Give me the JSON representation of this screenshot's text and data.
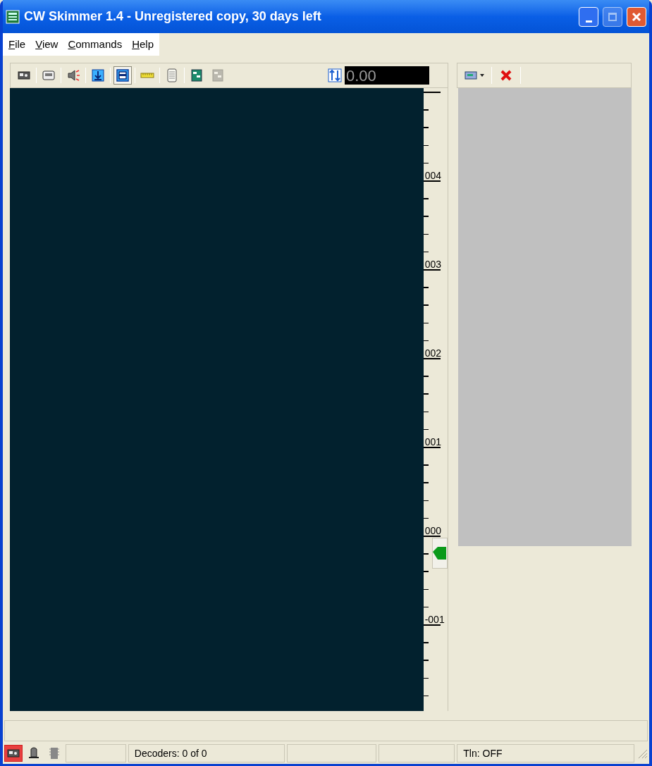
{
  "window": {
    "title": "CW Skimmer 1.4 - Unregistered copy, 30 days left"
  },
  "menu": [
    {
      "key": "F",
      "rest": "ile"
    },
    {
      "key": "V",
      "rest": "iew"
    },
    {
      "key": "C",
      "rest": "ommands"
    },
    {
      "key": "H",
      "rest": "elp"
    }
  ],
  "toolbar": [
    {
      "kind": "radio",
      "pressed": false,
      "disabled": false
    },
    {
      "kind": "separator"
    },
    {
      "kind": "cassette",
      "pressed": false,
      "disabled": false
    },
    {
      "kind": "separator"
    },
    {
      "kind": "speaker",
      "pressed": false,
      "disabled": false
    },
    {
      "kind": "separator"
    },
    {
      "kind": "down-box",
      "pressed": false,
      "disabled": false
    },
    {
      "kind": "separator"
    },
    {
      "kind": "window",
      "pressed": true,
      "disabled": false
    },
    {
      "kind": "separator"
    },
    {
      "kind": "ruler",
      "pressed": false,
      "disabled": false
    },
    {
      "kind": "separator"
    },
    {
      "kind": "notepad",
      "pressed": false,
      "disabled": false
    },
    {
      "kind": "separator"
    },
    {
      "kind": "panel",
      "pressed": false,
      "disabled": false
    },
    {
      "kind": "panel",
      "pressed": false,
      "disabled": true
    }
  ],
  "frequency": {
    "value": "0.00"
  },
  "scale": {
    "labels": [
      "004",
      "003",
      "002",
      "001",
      "000",
      "-001"
    ]
  },
  "right_toolbar": [
    {
      "kind": "card-dropdown"
    },
    {
      "kind": "separator"
    },
    {
      "kind": "delete"
    },
    {
      "kind": "separator"
    }
  ],
  "status_bar": {
    "icons": [
      {
        "kind": "radio",
        "selected": true
      },
      {
        "kind": "bell",
        "selected": false
      },
      {
        "kind": "chip",
        "selected": false
      }
    ],
    "panels": [
      "Decoders: 0 of 0",
      "Tln: OFF"
    ]
  }
}
